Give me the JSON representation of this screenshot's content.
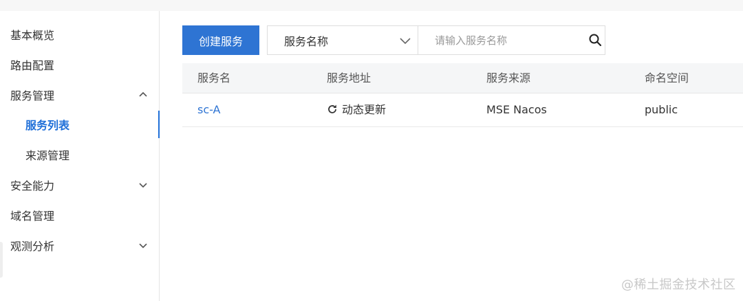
{
  "sidebar": {
    "items": [
      {
        "label": "基本概览"
      },
      {
        "label": "路由配置"
      },
      {
        "label": "服务管理"
      },
      {
        "label": "服务列表"
      },
      {
        "label": "来源管理"
      },
      {
        "label": "安全能力"
      },
      {
        "label": "域名管理"
      },
      {
        "label": "观测分析"
      }
    ]
  },
  "toolbar": {
    "create_label": "创建服务",
    "filter_select_value": "服务名称",
    "search_placeholder": "请输入服务名称"
  },
  "table": {
    "headers": [
      "服务名",
      "服务地址",
      "服务来源",
      "命名空间"
    ],
    "rows": [
      {
        "name": "sc-A",
        "address": "动态更新",
        "source": "MSE Nacos",
        "namespace": "public"
      }
    ]
  },
  "watermark": "@稀土掘金技术社区",
  "colors": {
    "accent": "#2e74d3",
    "active_nav": "#1f6fd8"
  },
  "icons": {
    "collapse": "chevron-up-icon",
    "expand": "chevron-down-icon",
    "search": "search-icon",
    "refresh": "refresh-icon"
  }
}
